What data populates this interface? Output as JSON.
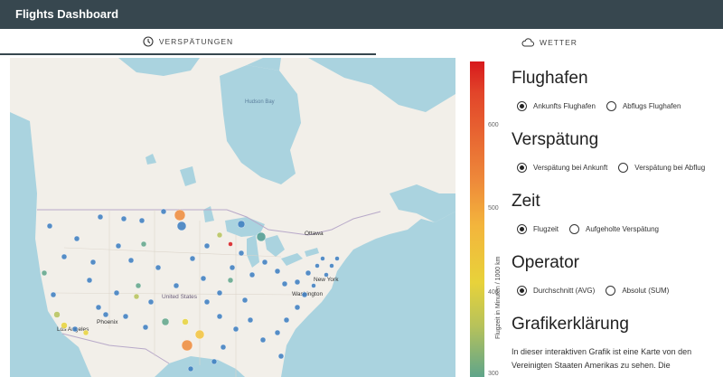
{
  "app": {
    "title": "Flights Dashboard"
  },
  "tabs": [
    {
      "label": "VERSPÄTUNGEN",
      "icon": "clock-icon",
      "active": true
    },
    {
      "label": "WETTER",
      "icon": "cloud-icon",
      "active": false
    }
  ],
  "map": {
    "labels": {
      "hudson_bay": "Hudson Bay",
      "ottawa": "Ottawa",
      "new_york": "New York",
      "washington": "Washington",
      "united_states": "United States",
      "phoenix": "Phoenix",
      "los_angeles": "Los Angeles"
    }
  },
  "colorbar": {
    "ticks": [
      "600",
      "500",
      "400",
      "300"
    ],
    "label": "Flugzeit in Minuten / 1000 km",
    "colors": [
      "#d7191c",
      "#ee8a3a",
      "#f3b53c",
      "#e8d23a",
      "#5fa58a"
    ]
  },
  "controls": {
    "airport": {
      "title": "Flughafen",
      "options": [
        "Ankunfts Flughafen",
        "Abflugs Flughafen"
      ],
      "selected": "Ankunfts Flughafen"
    },
    "delay": {
      "title": "Verspätung",
      "options": [
        "Verspätung bei Ankunft",
        "Verspätung bei Abflug"
      ],
      "selected": "Verspätung bei Ankunft"
    },
    "time": {
      "title": "Zeit",
      "options": [
        "Flugzeit",
        "Aufgeholte Verspätung"
      ],
      "selected": "Flugzeit"
    },
    "operator": {
      "title": "Operator",
      "options": [
        "Durchschnitt (AVG)",
        "Absolut (SUM)"
      ],
      "selected": "Durchschnitt (AVG)"
    },
    "legend": {
      "title": "Grafikerklärung",
      "text": "In dieser interaktiven Grafik ist eine Karte von den Vereinigten Staaten Amerikas zu sehen. Die"
    }
  }
}
